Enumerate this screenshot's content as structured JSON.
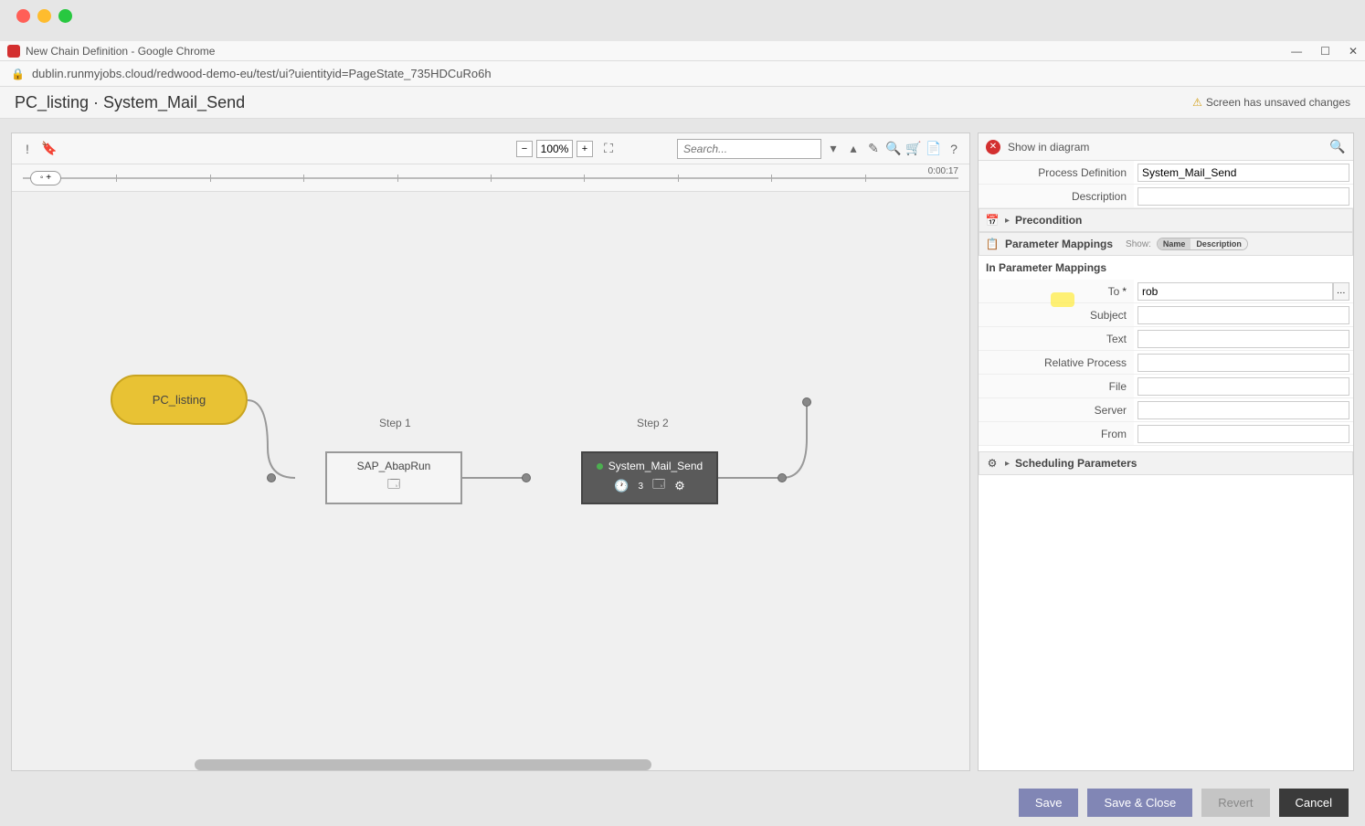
{
  "chrome": {
    "title": "New Chain Definition - Google Chrome",
    "url": "dublin.runmyjobs.cloud/redwood-demo-eu/test/ui?uientityid=PageState_735HDCuRo6h"
  },
  "page": {
    "breadcrumb": "PC_listing · System_Mail_Send",
    "warning": "Screen has unsaved changes"
  },
  "toolbar": {
    "zoom": "100%",
    "search_placeholder": "Search..."
  },
  "timeline": {
    "time": "0:00:17"
  },
  "diagram": {
    "start_node": "PC_listing",
    "step1_label": "Step 1",
    "step2_label": "Step 2",
    "node1": "SAP_AbapRun",
    "node2": "System_Mail_Send",
    "node2_badge": "3"
  },
  "props": {
    "header_title": "Show in diagram",
    "process_def_label": "Process Definition",
    "process_def_value": "System_Mail_Send",
    "description_label": "Description",
    "description_value": "",
    "precondition_label": "Precondition",
    "param_mappings_label": "Parameter Mappings",
    "show_label": "Show:",
    "toggle_name": "Name",
    "toggle_desc": "Description",
    "in_param_title": "In Parameter Mappings",
    "fields": {
      "to_label": "To",
      "to_value": "rob",
      "subject_label": "Subject",
      "subject_value": "",
      "text_label": "Text",
      "text_value": "",
      "relproc_label": "Relative Process",
      "relproc_value": "",
      "file_label": "File",
      "file_value": "",
      "server_label": "Server",
      "server_value": "",
      "from_label": "From",
      "from_value": ""
    },
    "sched_params_label": "Scheduling Parameters"
  },
  "actions": {
    "save": "Save",
    "save_close": "Save & Close",
    "revert": "Revert",
    "cancel": "Cancel"
  }
}
